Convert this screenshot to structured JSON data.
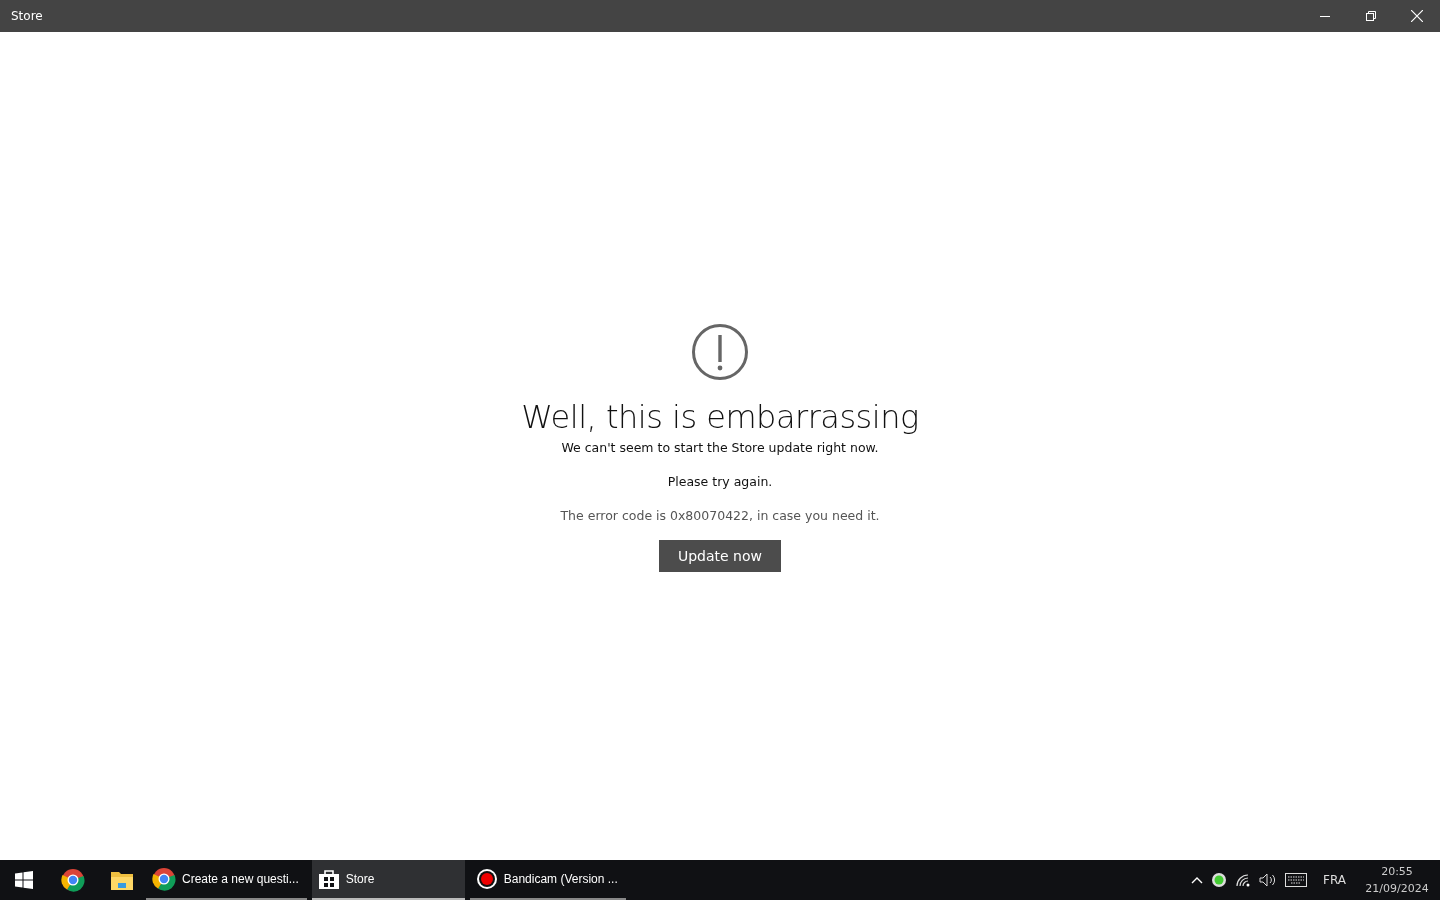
{
  "window": {
    "title": "Store"
  },
  "error": {
    "heading": "Well, this is embarrassing",
    "message": "We can't seem to start the Store update right now.",
    "retry": "Please try again.",
    "code_note": "The error code is 0x80070422, in case you need it.",
    "button": "Update now"
  },
  "taskbar": {
    "items": [
      {
        "kind": "browser",
        "selected": false
      },
      {
        "kind": "folder",
        "selected": false
      },
      {
        "kind": "browser",
        "label": "Create a new questi...",
        "selected": false
      },
      {
        "kind": "store",
        "label": "Store",
        "selected": true
      },
      {
        "kind": "recorder",
        "label": "Bandicam (Version ...",
        "selected": false
      }
    ],
    "tray": {
      "language": "FRA",
      "time": "20:55",
      "date": "21/09/2024"
    }
  }
}
